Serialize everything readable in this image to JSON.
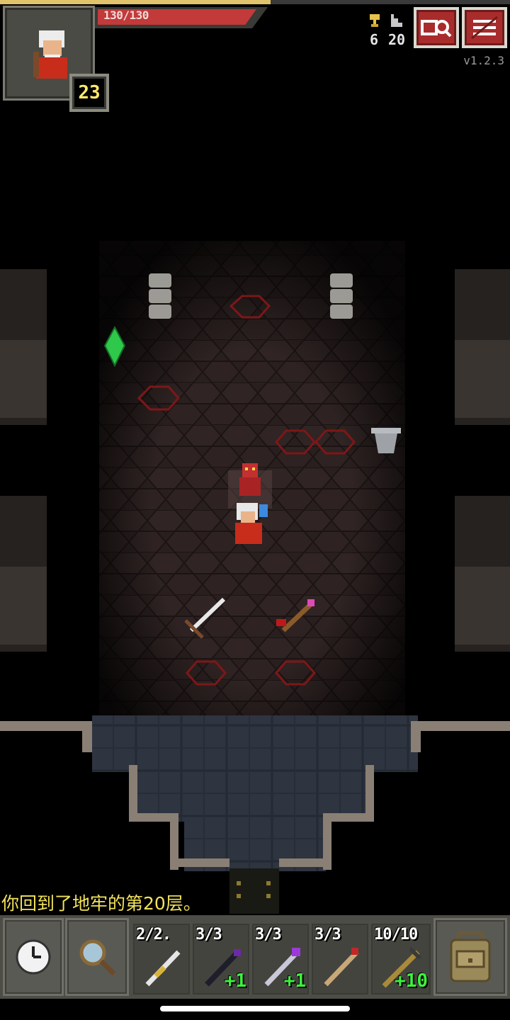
{
  "hud": {
    "hp_text": "130/130",
    "hp_fraction": 1.0,
    "xp_fraction": 0.53,
    "level": "23",
    "gold": "6",
    "depth": "20",
    "version": "v1.2.3",
    "journal_icon": "journal-search-icon",
    "menu_icon": "menu-icon"
  },
  "log": {
    "message": "你回到了地牢的第20层。"
  },
  "toolbar": {
    "wait_icon": "clock-icon",
    "search_icon": "magnifier-icon",
    "backpack_icon": "backpack-icon",
    "quickslots": [
      {
        "count": "2/2.",
        "bonus": "",
        "item": "wand-gold"
      },
      {
        "count": "3/3",
        "bonus": "+1",
        "item": "wand-dark"
      },
      {
        "count": "3/3",
        "bonus": "+1",
        "item": "wand-purple"
      },
      {
        "count": "3/3",
        "bonus": "",
        "item": "wand-red"
      },
      {
        "count": "10/10",
        "bonus": "+10",
        "item": "pickaxe-staff"
      }
    ]
  },
  "colors": {
    "hp": "#c23a3a",
    "xp": "#e0c36a",
    "log_text": "#f1e25a",
    "bonus": "#3cf23c",
    "button_red": "#a92c2c"
  }
}
